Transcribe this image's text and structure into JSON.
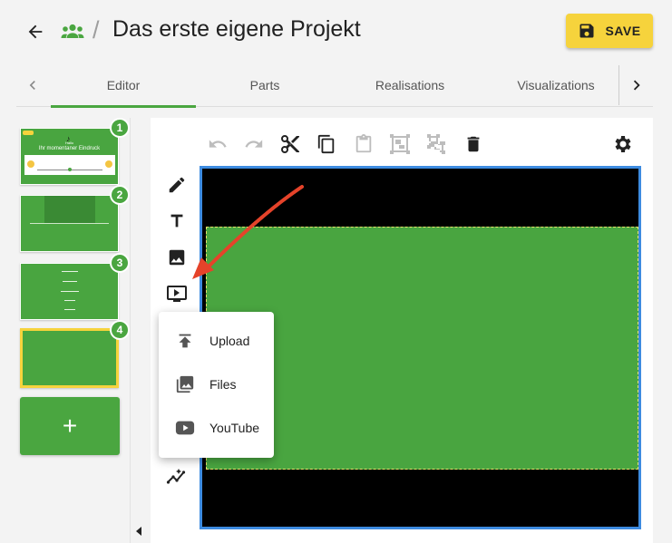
{
  "header": {
    "title": "Das erste eigene Projekt",
    "breadcrumb_separator": "/",
    "save_label": "SAVE"
  },
  "tabs": [
    {
      "label": "Editor",
      "active": true
    },
    {
      "label": "Parts",
      "active": false
    },
    {
      "label": "Realisations",
      "active": false
    },
    {
      "label": "Visualizations",
      "active": false
    }
  ],
  "slides": [
    {
      "number": "1",
      "text_lines": [
        "Hallo",
        "Ihr momentaner Eindruck"
      ]
    },
    {
      "number": "2"
    },
    {
      "number": "3"
    },
    {
      "number": "4",
      "selected": true
    }
  ],
  "add_slide_label": "+",
  "toolbar": {
    "icons": [
      "undo-icon",
      "redo-icon",
      "cut-icon",
      "copy-icon",
      "paste-icon",
      "group-icon",
      "ungroup-icon",
      "delete-icon",
      "settings-icon"
    ]
  },
  "tools": [
    "pencil-icon",
    "text-icon",
    "image-icon",
    "video-icon",
    "chart-icon"
  ],
  "media_menu": {
    "items": [
      {
        "label": "Upload",
        "icon": "upload-icon"
      },
      {
        "label": "Files",
        "icon": "photo-library-icon"
      },
      {
        "label": "YouTube",
        "icon": "youtube-icon"
      }
    ]
  },
  "colors": {
    "accent_green": "#4aa640",
    "save_yellow": "#f6d33c",
    "canvas_border": "#3d8be0",
    "annotation_arrow": "#e5432a"
  }
}
